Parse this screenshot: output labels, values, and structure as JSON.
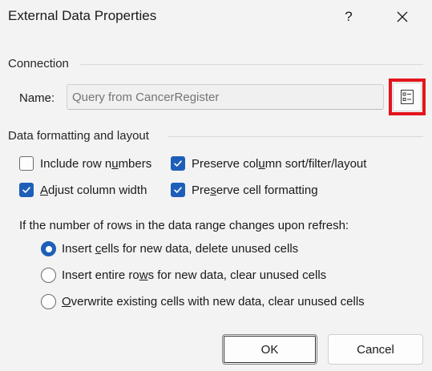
{
  "window": {
    "title": "External Data Properties",
    "help_label": "?"
  },
  "connection": {
    "section_label": "Connection",
    "name_label": "Name:",
    "name_placeholder": "Query from CancerRegister"
  },
  "formatting": {
    "section_label": "Data formatting and layout",
    "checkboxes": [
      {
        "pre": "Include row n",
        "accel": "u",
        "post": "mbers",
        "checked": false
      },
      {
        "pre": "Preserve col",
        "accel": "u",
        "post": "mn sort/filter/layout",
        "checked": true
      },
      {
        "pre": "",
        "accel": "A",
        "post": "djust column width",
        "checked": true
      },
      {
        "pre": "Pre",
        "accel": "s",
        "post": "erve cell formatting",
        "checked": true
      }
    ]
  },
  "refresh": {
    "label": "If the number of rows in the data range changes upon refresh:",
    "options": [
      {
        "pre": "Insert ",
        "accel": "c",
        "post": "ells for new data, delete unused cells",
        "selected": true
      },
      {
        "pre": "Insert entire ro",
        "accel": "w",
        "post": "s for new data, clear unused cells",
        "selected": false
      },
      {
        "pre": "",
        "accel": "O",
        "post": "verwrite existing cells with new data, clear unused cells",
        "selected": false
      }
    ]
  },
  "buttons": {
    "ok_label": "OK",
    "cancel_label": "Cancel"
  },
  "colors": {
    "accent": "#1d5fb8",
    "highlight_frame": "#e3141c"
  }
}
